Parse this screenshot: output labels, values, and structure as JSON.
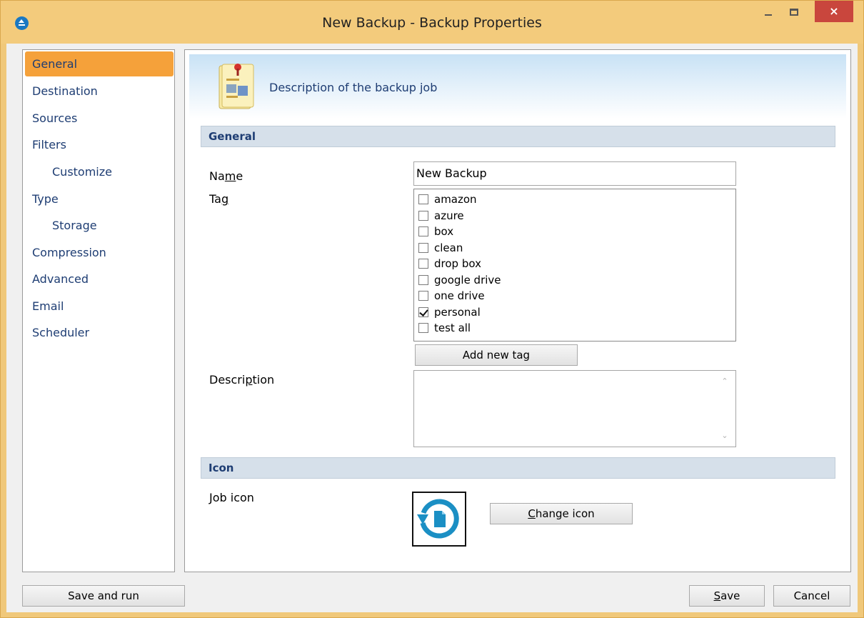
{
  "window": {
    "title": "New Backup - Backup Properties",
    "close_glyph": "×"
  },
  "sidebar": {
    "items": [
      {
        "label": "General",
        "active": true
      },
      {
        "label": "Destination"
      },
      {
        "label": "Sources"
      },
      {
        "label": "Filters"
      },
      {
        "label": "Customize",
        "sub": true
      },
      {
        "label": "Type"
      },
      {
        "label": "Storage",
        "sub": true
      },
      {
        "label": "Compression"
      },
      {
        "label": "Advanced"
      },
      {
        "label": "Email"
      },
      {
        "label": "Scheduler"
      }
    ]
  },
  "banner": {
    "text": "Description of the backup job",
    "icon": "clipboard-note-icon"
  },
  "general": {
    "header": "General",
    "name_label_pre": "Na",
    "name_label_u": "m",
    "name_label_post": "e",
    "name_value": "New Backup",
    "tag_label_pre": "Ta",
    "tag_label_u": "g",
    "tags": [
      {
        "label": "amazon",
        "checked": false
      },
      {
        "label": "azure",
        "checked": false
      },
      {
        "label": "box",
        "checked": false
      },
      {
        "label": "clean",
        "checked": false
      },
      {
        "label": "drop box",
        "checked": false
      },
      {
        "label": "google drive",
        "checked": false
      },
      {
        "label": "one drive",
        "checked": false
      },
      {
        "label": "personal",
        "checked": true
      },
      {
        "label": "test all",
        "checked": false
      }
    ],
    "add_tag_label": "Add new tag",
    "description_label_pre": "Descri",
    "description_label_u": "p",
    "description_label_post": "tion",
    "description_value": ""
  },
  "icon_section": {
    "header": "Icon",
    "job_icon_label": "Job icon",
    "change_icon_u": "C",
    "change_icon_rest": "hange icon",
    "icon_name": "backup-restore-document-icon",
    "icon_color": "#1b8fc4"
  },
  "footer": {
    "save_and_run": "Save and run",
    "save_u": "S",
    "save_rest": "ave",
    "cancel": "Cancel"
  },
  "colors": {
    "titlebar": "#f3cb7c",
    "active_nav": "#f5a13a",
    "nav_text": "#1e3d73",
    "close_button": "#c9463d"
  }
}
